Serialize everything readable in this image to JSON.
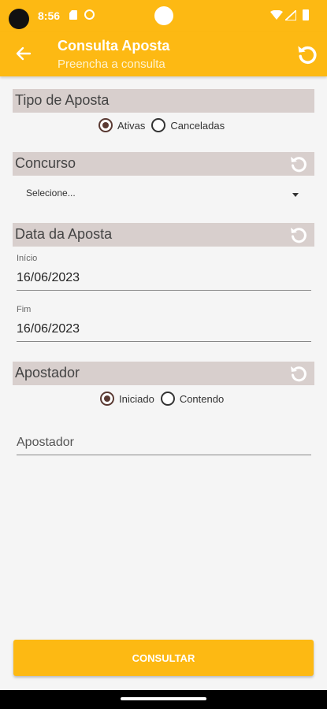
{
  "status_bar": {
    "time": "8:56"
  },
  "app_bar": {
    "title": "Consulta Aposta",
    "subtitle": "Preencha a consulta"
  },
  "tipo": {
    "header": "Tipo de Aposta",
    "options": [
      {
        "label": "Ativas",
        "checked": true
      },
      {
        "label": "Canceladas",
        "checked": false
      }
    ]
  },
  "concurso": {
    "header": "Concurso",
    "select_value": "Selecione..."
  },
  "data": {
    "header": "Data da Aposta",
    "inicio_label": "Início",
    "inicio_value": "16/06/2023",
    "fim_label": "Fim",
    "fim_value": "16/06/2023"
  },
  "apostador": {
    "header": "Apostador",
    "options": [
      {
        "label": "Iniciado",
        "checked": true
      },
      {
        "label": "Contendo",
        "checked": false
      }
    ],
    "placeholder": "Apostador"
  },
  "consult_button": "CONSULTAR",
  "colors": {
    "accent": "#fdb913",
    "section_bg": "#d8cfcd",
    "radio": "#5a3a33"
  },
  "icons": [
    "back-arrow-icon",
    "refresh-icon",
    "reset-icon",
    "caret-down-icon"
  ]
}
